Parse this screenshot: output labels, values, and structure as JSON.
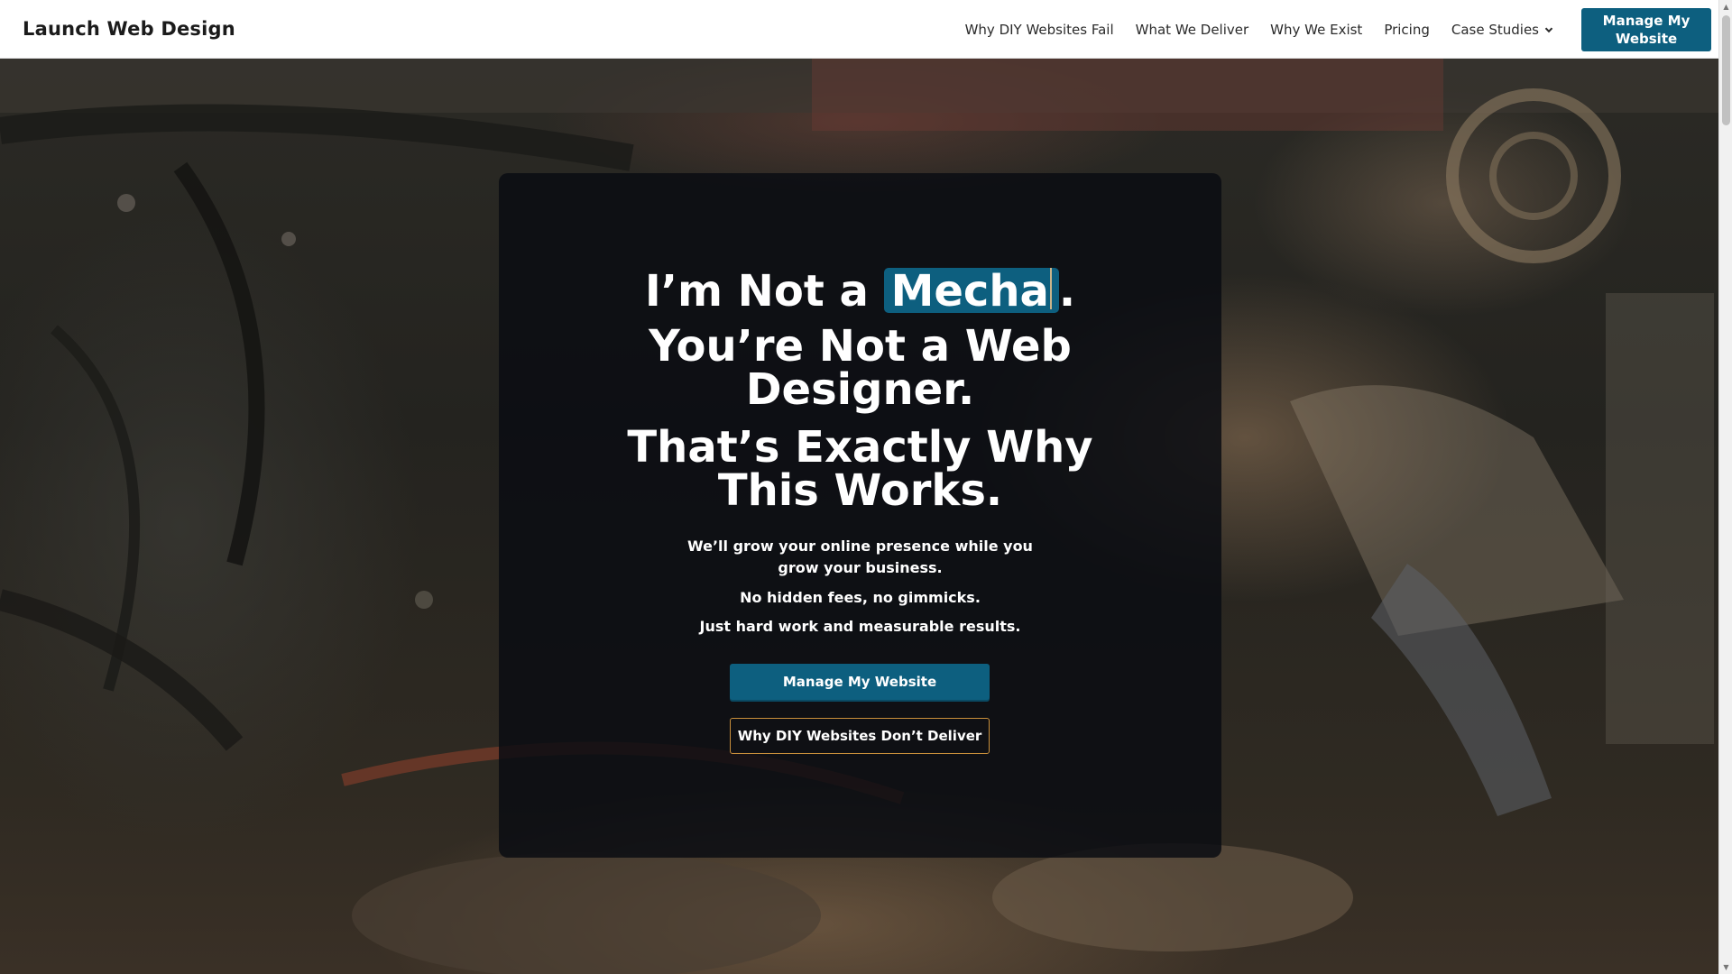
{
  "header": {
    "brand": "Launch Web Design",
    "nav": [
      {
        "label": "Why DIY Websites Fail"
      },
      {
        "label": "What We Deliver"
      },
      {
        "label": "Why We Exist"
      },
      {
        "label": "Pricing"
      },
      {
        "label": "Case Studies",
        "icon": "chevron-down-icon"
      }
    ],
    "cta_label": "Manage My Website"
  },
  "hero": {
    "line1_prefix": "I’m Not a ",
    "line1_typed": "Mecha",
    "line1_suffix": ".",
    "line2": "You’re Not a Web Designer.",
    "line3": "That’s Exactly Why This Works.",
    "sub1": "We’ll grow your online presence while you grow your business.",
    "sub2": "No hidden fees, no gimmicks.",
    "sub3": "Just hard work and measurable results.",
    "primary_button": "Manage My Website",
    "secondary_button": "Why DIY Websites Don’t Deliver"
  },
  "colors": {
    "accent": "#0d5f7f",
    "outline": "#c98f3b",
    "overlay": "#0a0c12"
  }
}
